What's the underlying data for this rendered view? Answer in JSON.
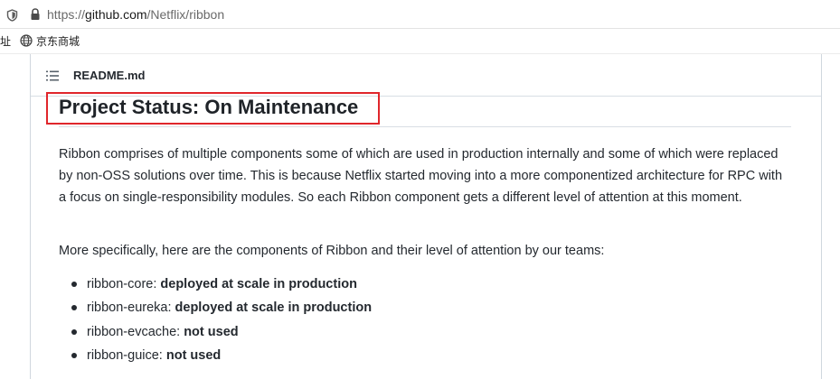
{
  "browser": {
    "url_proto": "https://",
    "url_host": "github.com",
    "url_path": "/Netflix/ribbon"
  },
  "bookmarks": {
    "truncated_label": "址",
    "items": [
      {
        "label": "京东商城",
        "icon": "globe-icon"
      }
    ]
  },
  "readme": {
    "file_name": "README.md",
    "heading": "Project Status: On Maintenance",
    "paragraph": "Ribbon comprises of multiple components some of which are used in production internally and some of which were replaced by non-OSS solutions over time. This is because Netflix started moving into a more componentized architecture for RPC with a focus on single-responsibility modules. So each Ribbon component gets a different level of attention at this moment.",
    "intro": "More specifically, here are the components of Ribbon and their level of attention by our teams:",
    "components": [
      {
        "name": "ribbon-core:",
        "status": "deployed at scale in production"
      },
      {
        "name": "ribbon-eureka:",
        "status": "deployed at scale in production"
      },
      {
        "name": "ribbon-evcache:",
        "status": "not used"
      },
      {
        "name": "ribbon-guice:",
        "status": "not used"
      }
    ]
  },
  "colors": {
    "highlight_border": "#e0262b",
    "text": "#24292f",
    "border": "#d0d7de"
  }
}
